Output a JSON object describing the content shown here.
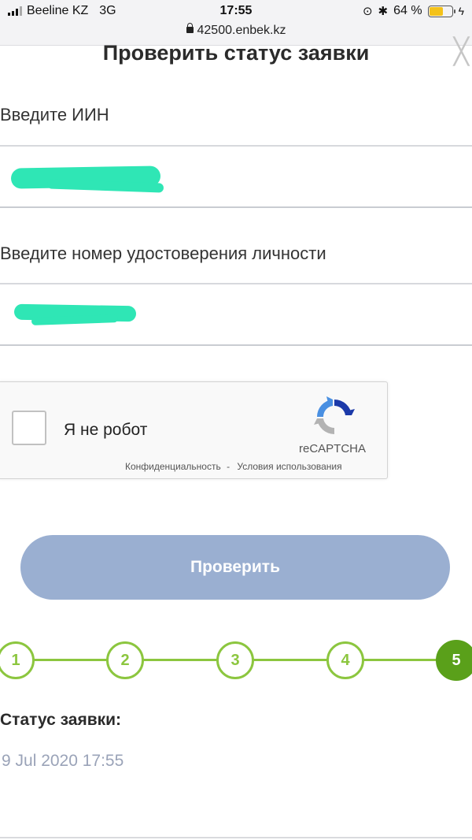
{
  "status_bar": {
    "carrier": "Beeline KZ",
    "network": "3G",
    "time": "17:55",
    "battery": "64 %",
    "battery_level": 0.64,
    "url": "42500.enbek.kz"
  },
  "form": {
    "title": "Проверить статус заявки",
    "iin_label": "Введите ИИН",
    "iin_value": "",
    "id_label": "Введите номер удостоверения личности",
    "id_value": ""
  },
  "captcha": {
    "label": "Я не робот",
    "brand": "reCAPTCHA",
    "privacy": "Конфиденциальность",
    "separator": "-",
    "terms": "Условия использования"
  },
  "button": {
    "label": "Проверить",
    "color": "#9aafd1"
  },
  "steps": {
    "items": [
      "1",
      "2",
      "3",
      "4",
      "5"
    ],
    "active_index": 4,
    "color": "#8cc63f",
    "active_color": "#5aa01a"
  },
  "status": {
    "title": "Статус заявки:",
    "date": "9 Jul 2020 17:55"
  },
  "redaction_color": "#2fe6b5"
}
